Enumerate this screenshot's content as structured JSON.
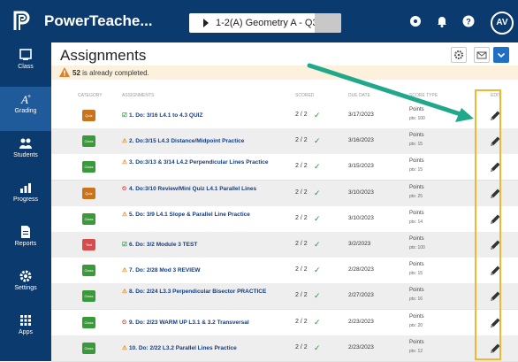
{
  "header": {
    "app_name": "PowerTeache...",
    "class_selector": "1-2(A) Geometry A - Q3",
    "avatar_initials": "AV"
  },
  "sidebar": {
    "items": [
      {
        "label": "Class",
        "icon": "class-icon",
        "active": false
      },
      {
        "label": "Grading",
        "icon": "grading-icon",
        "active": true
      },
      {
        "label": "Students",
        "icon": "students-icon",
        "active": false
      },
      {
        "label": "Progress",
        "icon": "progress-icon",
        "active": false
      },
      {
        "label": "Reports",
        "icon": "reports-icon",
        "active": false
      },
      {
        "label": "Settings",
        "icon": "settings-icon",
        "active": false
      },
      {
        "label": "Apps",
        "icon": "apps-icon",
        "active": false
      }
    ]
  },
  "page": {
    "title": "Assignments",
    "warning_count": "52",
    "warning_text": "is already completed."
  },
  "table": {
    "columns": [
      "CATEGORY",
      "ASSIGNMENTS",
      "SCORED",
      "DUE DATE",
      "SCORE TYPE",
      "EDIT"
    ],
    "rows": [
      {
        "category": "Quiz",
        "cat_color": "#c9741d",
        "marker": "check",
        "name": "1. Do: 3/16 L4.1 to 4.3 QUIZ",
        "scored": "2 / 2",
        "due": "3/17/2023",
        "score_type": "Points",
        "pts": "pts: 100"
      },
      {
        "category": "Class",
        "cat_color": "#3a9a3a",
        "marker": "warn",
        "name": "2. Do:3/15 L4.3 Distance/Midpoint Practice",
        "scored": "2 / 2",
        "due": "3/16/2023",
        "score_type": "Points",
        "pts": "pts: 15"
      },
      {
        "category": "Class",
        "cat_color": "#3a9a3a",
        "marker": "warn",
        "name": "3. Do:3/13 & 3/14 L4.2 Perpendicular Lines Practice",
        "scored": "2 / 2",
        "due": "3/15/2023",
        "score_type": "Points",
        "pts": "pts: 15"
      },
      {
        "category": "Quiz",
        "cat_color": "#c9741d",
        "marker": "clock",
        "name": "4. Do:3/10 Review/Mini Quiz L4.1 Parallel Lines",
        "scored": "2 / 2",
        "due": "3/10/2023",
        "score_type": "Points",
        "pts": "pts: 25"
      },
      {
        "category": "Class",
        "cat_color": "#3a9a3a",
        "marker": "warn",
        "name": "5. Do: 3/9 L4.1 Slope & Parallel Line Practice",
        "scored": "2 / 2",
        "due": "3/10/2023",
        "score_type": "Points",
        "pts": "pts: 14"
      },
      {
        "category": "Test",
        "cat_color": "#d64b4b",
        "marker": "check",
        "name": "6. Do: 3/2 Module 3 TEST",
        "scored": "2 / 2",
        "due": "3/2/2023",
        "score_type": "Points",
        "pts": "pts: 100"
      },
      {
        "category": "Class",
        "cat_color": "#3a9a3a",
        "marker": "warn",
        "name": "7. Do: 2/28 Mod 3 REVIEW",
        "scored": "2 / 2",
        "due": "2/28/2023",
        "score_type": "Points",
        "pts": "pts: 15"
      },
      {
        "category": "Class",
        "cat_color": "#3a9a3a",
        "marker": "warn",
        "name": "8. Do: 2/24 L3.3 Perpendicular Bisector PRACTICE",
        "scored": "2 / 2",
        "due": "2/27/2023",
        "score_type": "Points",
        "pts": "pts: 16"
      },
      {
        "category": "Class",
        "cat_color": "#3a9a3a",
        "marker": "clock",
        "name": "9. Do: 2/23 WARM UP L3.1 & 3.2 Transversal",
        "scored": "2 / 2",
        "due": "2/23/2023",
        "score_type": "Points",
        "pts": "pts: 20"
      },
      {
        "category": "Class",
        "cat_color": "#3a9a3a",
        "marker": "warn",
        "name": "10. Do: 2/22 L3.2 Parallel Lines Practice",
        "scored": "2 / 2",
        "due": "2/23/2023",
        "score_type": "Points",
        "pts": "pts: 12"
      }
    ]
  },
  "colors": {
    "header_bg": "#0a3a6e",
    "highlight": "#f2b730",
    "arrow": "#1fa88a"
  }
}
